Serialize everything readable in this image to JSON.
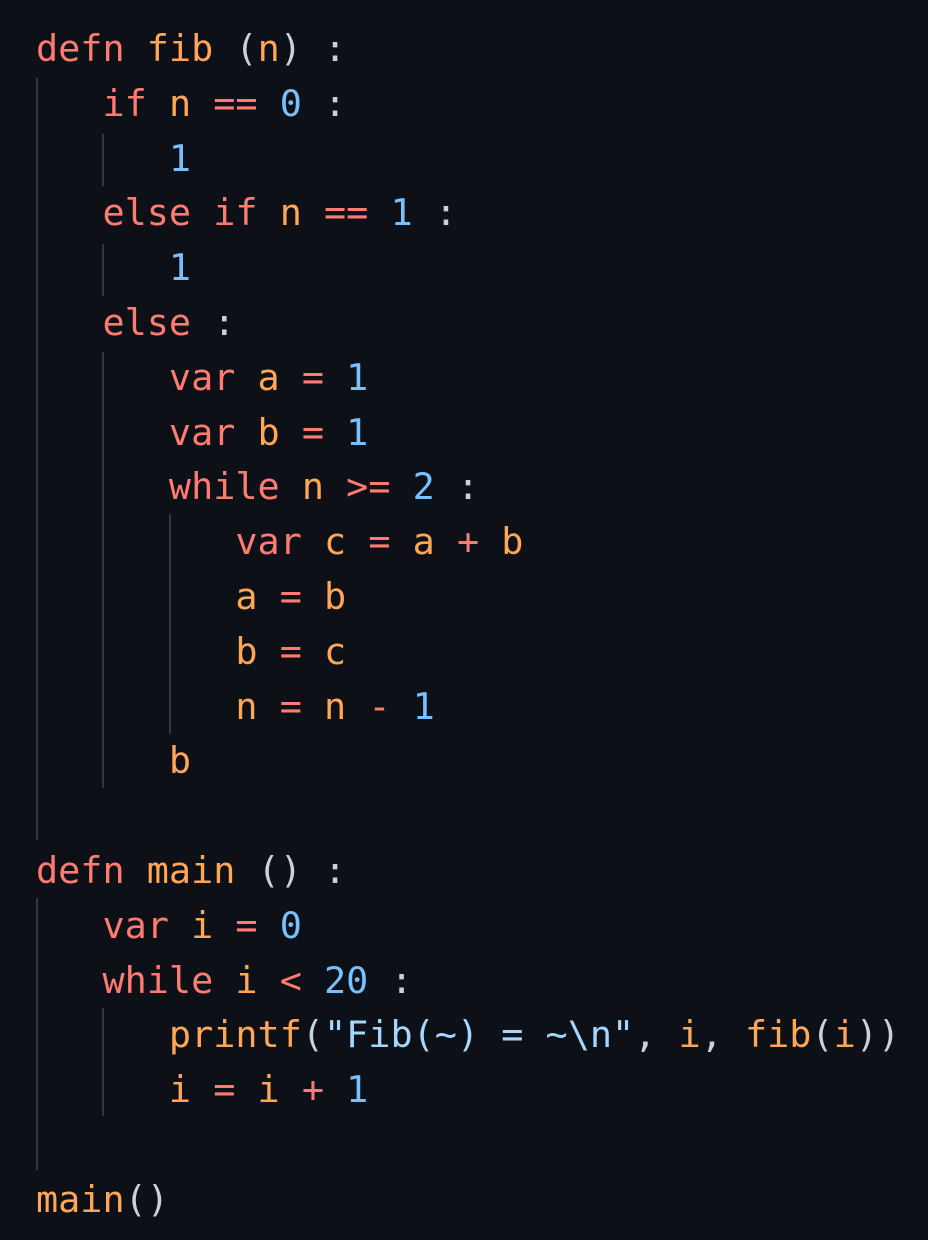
{
  "colors": {
    "background": "#0d1117",
    "keyword": "#ff7b72",
    "identifier": "#ffa657",
    "number": "#79c0ff",
    "punctuation": "#c9d1d9",
    "string": "#a5d6ff",
    "indent_guide": "#30363d"
  },
  "lines": [
    {
      "indent": 0,
      "tokens": [
        [
          "kw",
          "defn"
        ],
        [
          "sp",
          " "
        ],
        [
          "fn",
          "fib"
        ],
        [
          "sp",
          " "
        ],
        [
          "punc",
          "("
        ],
        [
          "fn",
          "n"
        ],
        [
          "punc",
          ")"
        ],
        [
          "sp",
          " "
        ],
        [
          "punc",
          ":"
        ]
      ]
    },
    {
      "indent": 1,
      "tokens": [
        [
          "kw",
          "if"
        ],
        [
          "sp",
          " "
        ],
        [
          "fn",
          "n"
        ],
        [
          "sp",
          " "
        ],
        [
          "kw",
          "=="
        ],
        [
          "sp",
          " "
        ],
        [
          "num",
          "0"
        ],
        [
          "sp",
          " "
        ],
        [
          "punc",
          ":"
        ]
      ]
    },
    {
      "indent": 2,
      "tokens": [
        [
          "num",
          "1"
        ]
      ]
    },
    {
      "indent": 1,
      "tokens": [
        [
          "kw",
          "else"
        ],
        [
          "sp",
          " "
        ],
        [
          "kw",
          "if"
        ],
        [
          "sp",
          " "
        ],
        [
          "fn",
          "n"
        ],
        [
          "sp",
          " "
        ],
        [
          "kw",
          "=="
        ],
        [
          "sp",
          " "
        ],
        [
          "num",
          "1"
        ],
        [
          "sp",
          " "
        ],
        [
          "punc",
          ":"
        ]
      ]
    },
    {
      "indent": 2,
      "tokens": [
        [
          "num",
          "1"
        ]
      ]
    },
    {
      "indent": 1,
      "tokens": [
        [
          "kw",
          "else"
        ],
        [
          "sp",
          " "
        ],
        [
          "punc",
          ":"
        ]
      ]
    },
    {
      "indent": 2,
      "tokens": [
        [
          "kw",
          "var"
        ],
        [
          "sp",
          " "
        ],
        [
          "fn",
          "a"
        ],
        [
          "sp",
          " "
        ],
        [
          "kw",
          "="
        ],
        [
          "sp",
          " "
        ],
        [
          "num",
          "1"
        ]
      ]
    },
    {
      "indent": 2,
      "tokens": [
        [
          "kw",
          "var"
        ],
        [
          "sp",
          " "
        ],
        [
          "fn",
          "b"
        ],
        [
          "sp",
          " "
        ],
        [
          "kw",
          "="
        ],
        [
          "sp",
          " "
        ],
        [
          "num",
          "1"
        ]
      ]
    },
    {
      "indent": 2,
      "tokens": [
        [
          "kw",
          "while"
        ],
        [
          "sp",
          " "
        ],
        [
          "fn",
          "n"
        ],
        [
          "sp",
          " "
        ],
        [
          "kw",
          ">="
        ],
        [
          "sp",
          " "
        ],
        [
          "num",
          "2"
        ],
        [
          "sp",
          " "
        ],
        [
          "punc",
          ":"
        ]
      ]
    },
    {
      "indent": 3,
      "tokens": [
        [
          "kw",
          "var"
        ],
        [
          "sp",
          " "
        ],
        [
          "fn",
          "c"
        ],
        [
          "sp",
          " "
        ],
        [
          "kw",
          "="
        ],
        [
          "sp",
          " "
        ],
        [
          "fn",
          "a"
        ],
        [
          "sp",
          " "
        ],
        [
          "kw",
          "+"
        ],
        [
          "sp",
          " "
        ],
        [
          "fn",
          "b"
        ]
      ]
    },
    {
      "indent": 3,
      "tokens": [
        [
          "fn",
          "a"
        ],
        [
          "sp",
          " "
        ],
        [
          "kw",
          "="
        ],
        [
          "sp",
          " "
        ],
        [
          "fn",
          "b"
        ]
      ]
    },
    {
      "indent": 3,
      "tokens": [
        [
          "fn",
          "b"
        ],
        [
          "sp",
          " "
        ],
        [
          "kw",
          "="
        ],
        [
          "sp",
          " "
        ],
        [
          "fn",
          "c"
        ]
      ]
    },
    {
      "indent": 3,
      "tokens": [
        [
          "fn",
          "n"
        ],
        [
          "sp",
          " "
        ],
        [
          "kw",
          "="
        ],
        [
          "sp",
          " "
        ],
        [
          "fn",
          "n"
        ],
        [
          "sp",
          " "
        ],
        [
          "kw",
          "-"
        ],
        [
          "sp",
          " "
        ],
        [
          "num",
          "1"
        ]
      ]
    },
    {
      "indent": 2,
      "tokens": [
        [
          "fn",
          "b"
        ]
      ]
    },
    {
      "indent": 0,
      "tokens": []
    },
    {
      "indent": 0,
      "tokens": [
        [
          "kw",
          "defn"
        ],
        [
          "sp",
          " "
        ],
        [
          "fn",
          "main"
        ],
        [
          "sp",
          " "
        ],
        [
          "punc",
          "()"
        ],
        [
          "sp",
          " "
        ],
        [
          "punc",
          ":"
        ]
      ]
    },
    {
      "indent": 1,
      "tokens": [
        [
          "kw",
          "var"
        ],
        [
          "sp",
          " "
        ],
        [
          "fn",
          "i"
        ],
        [
          "sp",
          " "
        ],
        [
          "kw",
          "="
        ],
        [
          "sp",
          " "
        ],
        [
          "num",
          "0"
        ]
      ]
    },
    {
      "indent": 1,
      "tokens": [
        [
          "kw",
          "while"
        ],
        [
          "sp",
          " "
        ],
        [
          "fn",
          "i"
        ],
        [
          "sp",
          " "
        ],
        [
          "kw",
          "<"
        ],
        [
          "sp",
          " "
        ],
        [
          "num",
          "20"
        ],
        [
          "sp",
          " "
        ],
        [
          "punc",
          ":"
        ]
      ]
    },
    {
      "indent": 2,
      "tokens": [
        [
          "fn",
          "printf"
        ],
        [
          "punc",
          "("
        ],
        [
          "str",
          "\"Fib(~) = ~\\n\""
        ],
        [
          "punc",
          ","
        ],
        [
          "sp",
          " "
        ],
        [
          "fn",
          "i"
        ],
        [
          "punc",
          ","
        ],
        [
          "sp",
          " "
        ],
        [
          "fn",
          "fib"
        ],
        [
          "punc",
          "("
        ],
        [
          "fn",
          "i"
        ],
        [
          "punc",
          "))"
        ]
      ]
    },
    {
      "indent": 2,
      "tokens": [
        [
          "fn",
          "i"
        ],
        [
          "sp",
          " "
        ],
        [
          "kw",
          "="
        ],
        [
          "sp",
          " "
        ],
        [
          "fn",
          "i"
        ],
        [
          "sp",
          " "
        ],
        [
          "kw",
          "+"
        ],
        [
          "sp",
          " "
        ],
        [
          "num",
          "1"
        ]
      ]
    },
    {
      "indent": 0,
      "tokens": []
    },
    {
      "indent": 0,
      "tokens": [
        [
          "fn",
          "main"
        ],
        [
          "punc",
          "()"
        ]
      ]
    }
  ]
}
